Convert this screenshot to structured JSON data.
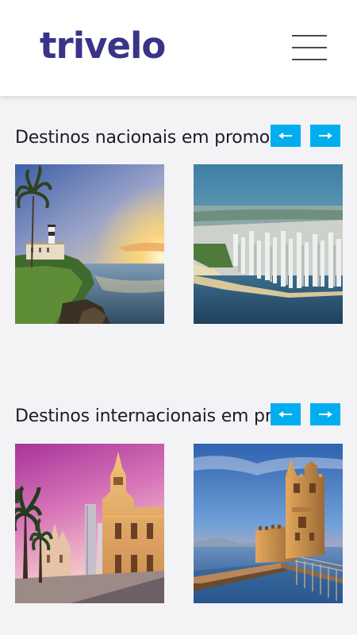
{
  "header": {
    "logo": "trivelo",
    "menu_icon": "hamburger-menu-icon"
  },
  "sections": [
    {
      "title": "Destinos nacionais em promoção",
      "prev_icon": "arrow-left-icon",
      "next_icon": "arrow-right-icon",
      "cards": [
        {
          "image": "salvador-lighthouse-sunset-photo"
        },
        {
          "image": "coastal-city-aerial-photo"
        }
      ]
    },
    {
      "title": "Destinos internacionais em promoção",
      "prev_icon": "arrow-left-icon",
      "next_icon": "arrow-right-icon",
      "cards": [
        {
          "image": "santiago-cathedral-plaza-photo"
        },
        {
          "image": "belem-tower-lisbon-photo"
        }
      ]
    }
  ],
  "colors": {
    "brand": "#3a3488",
    "accent": "#00aef0",
    "background": "#f3f3f5"
  }
}
